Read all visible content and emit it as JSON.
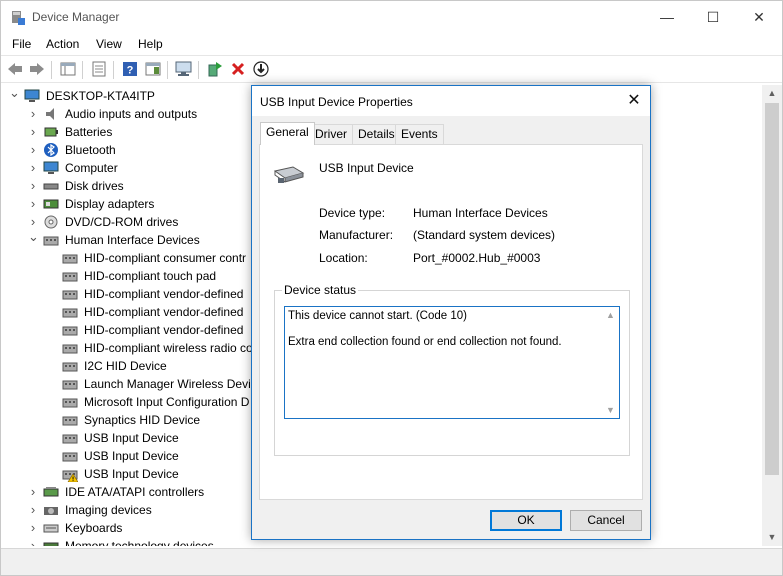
{
  "window": {
    "title": "Device Manager",
    "controls": {
      "minimize": "—",
      "maximize": "☐",
      "close": "✕"
    }
  },
  "menu": [
    "File",
    "Action",
    "View",
    "Help"
  ],
  "tree": {
    "root": "DESKTOP-KTA4ITP",
    "items": [
      {
        "label": "Audio inputs and outputs",
        "icon": "speaker-icon",
        "expanded": false
      },
      {
        "label": "Batteries",
        "icon": "battery-icon",
        "expanded": false
      },
      {
        "label": "Bluetooth",
        "icon": "bluetooth-icon",
        "expanded": false
      },
      {
        "label": "Computer",
        "icon": "monitor-icon",
        "expanded": false
      },
      {
        "label": "Disk drives",
        "icon": "disk-icon",
        "expanded": false
      },
      {
        "label": "Display adapters",
        "icon": "display-adapter-icon",
        "expanded": false
      },
      {
        "label": "DVD/CD-ROM drives",
        "icon": "dvd-icon",
        "expanded": false
      },
      {
        "label": "Human Interface Devices",
        "icon": "hid-icon",
        "expanded": true
      },
      {
        "label": "IDE ATA/ATAPI controllers",
        "icon": "ide-icon",
        "expanded": false
      },
      {
        "label": "Imaging devices",
        "icon": "camera-icon",
        "expanded": false
      },
      {
        "label": "Keyboards",
        "icon": "keyboard-icon",
        "expanded": false
      },
      {
        "label": "Memory technology devices",
        "icon": "memory-icon",
        "expanded": false
      }
    ],
    "hid_children": [
      {
        "label": "HID-compliant consumer contr",
        "warn": false
      },
      {
        "label": "HID-compliant touch pad",
        "warn": false
      },
      {
        "label": "HID-compliant vendor-defined",
        "warn": false
      },
      {
        "label": "HID-compliant vendor-defined",
        "warn": false
      },
      {
        "label": "HID-compliant vendor-defined",
        "warn": false
      },
      {
        "label": "HID-compliant wireless radio co",
        "warn": false
      },
      {
        "label": "I2C HID Device",
        "warn": false
      },
      {
        "label": "Launch Manager Wireless Devic",
        "warn": false
      },
      {
        "label": "Microsoft Input Configuration D",
        "warn": false
      },
      {
        "label": "Synaptics HID Device",
        "warn": false
      },
      {
        "label": "USB Input Device",
        "warn": false
      },
      {
        "label": "USB Input Device",
        "warn": false
      },
      {
        "label": "USB Input Device",
        "warn": true
      }
    ]
  },
  "dialog": {
    "title": "USB Input Device Properties",
    "close": "✕",
    "tabs": [
      "General",
      "Driver",
      "Details",
      "Events"
    ],
    "active_tab": "General",
    "device_name": "USB Input Device",
    "props": [
      {
        "label": "Device type:",
        "value": "Human Interface Devices"
      },
      {
        "label": "Manufacturer:",
        "value": "(Standard system devices)"
      },
      {
        "label": "Location:",
        "value": "Port_#0002.Hub_#0003"
      }
    ],
    "status_legend": "Device status",
    "status_line1": "This device cannot start. (Code 10)",
    "status_line2": "Extra end collection found or end collection not found.",
    "ok": "OK",
    "cancel": "Cancel"
  }
}
